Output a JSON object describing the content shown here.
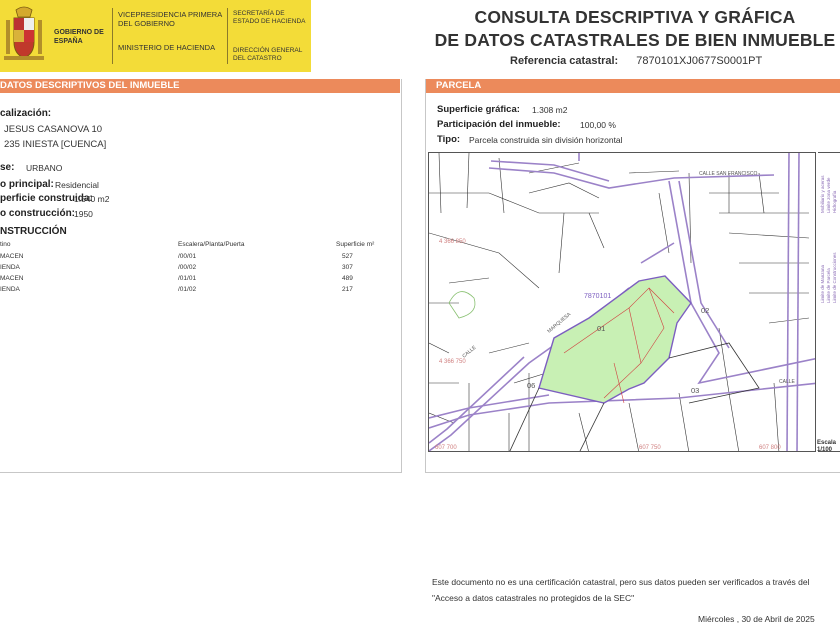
{
  "header": {
    "gobierno": "GOBIERNO DE ESPAÑA",
    "vicepresidencia": "VICEPRESIDENCIA PRIMERA DEL GOBIERNO",
    "ministerio": "MINISTERIO DE HACIENDA",
    "secretaria": "SECRETARÍA DE ESTADO DE HACIENDA",
    "direccion": "DIRECCIÓN GENERAL DEL CATASTRO",
    "title_line1": "CONSULTA DESCRIPTIVA Y GRÁFICA",
    "title_line2": "DE DATOS CATASTRALES DE BIEN INMUEBLE",
    "ref_label": "Referencia catastral:",
    "ref_value": "7870101XJ0677S0001PT"
  },
  "colors": {
    "yellow": "#f3dc38",
    "orange": "#ec8a5b",
    "parcel_fill": "#c8f0b4",
    "road": "#9b82c8"
  },
  "left": {
    "section": "DATOS DESCRIPTIVOS DEL INMUEBLE",
    "localizacion_label": "calización:",
    "addr1": "JESUS CASANOVA 10",
    "addr2": "235 INIESTA [CUENCA]",
    "clase_label": "se:",
    "clase_value": "URBANO",
    "uso_label": "o principal:",
    "uso_value": "Residencial",
    "sup_label": "perficie construida:",
    "sup_value": "1.540 m2",
    "anio_label": "o construcción:",
    "anio_value": "1950",
    "construccion_label": "NSTRUCCIÓN",
    "table": {
      "h_destino": "tino",
      "h_escalera": "Escalera/Planta/Puerta",
      "h_superficie": "Superficie m²",
      "rows": [
        {
          "destino": "MACEN",
          "epp": "/00/01",
          "sup": "527"
        },
        {
          "destino": "IENDA",
          "epp": "/00/02",
          "sup": "307"
        },
        {
          "destino": "MACEN",
          "epp": "/01/01",
          "sup": "489"
        },
        {
          "destino": "IENDA",
          "epp": "/01/02",
          "sup": "217"
        }
      ]
    }
  },
  "right": {
    "section": "PARCELA",
    "sup_grafica_label": "Superficie gráfica:",
    "sup_grafica_value": "1.308 m2",
    "participacion_label": "Participación del inmueble:",
    "participacion_value": "100,00 %",
    "tipo_label": "Tipo:",
    "tipo_value": "Parcela construida sin división horizontal"
  },
  "map": {
    "parcel_id": "7870101",
    "labels": {
      "p01": "01",
      "p02": "02",
      "p03": "03",
      "p06": "06",
      "street_top": "CALLE SAN FRANCISCO",
      "street_left": "CALLE",
      "street_name": "MARQUESA",
      "street_bottom": "CALLE",
      "coord_left": "4 366 850",
      "coord_left2": "4 366 750",
      "coord_b1": "607 700",
      "coord_b2": "607 750",
      "coord_b3": "607 800"
    },
    "legend": [
      "Limite de Manzana",
      "Limite de Parcela",
      "Limite de Construcciones",
      "Mobiliario y aceras",
      "Limite zona verde",
      "Hidrografía"
    ],
    "escala_label": "Escala",
    "escala_value": "1/100"
  },
  "footer": {
    "disclaimer": "Este documento no es una certificación catastral, pero sus datos pueden ser verificados a través del \"Acceso a datos catastrales no protegidos de la SEC\"",
    "fecha": "Miércoles , 30 de Abril de 2025"
  }
}
